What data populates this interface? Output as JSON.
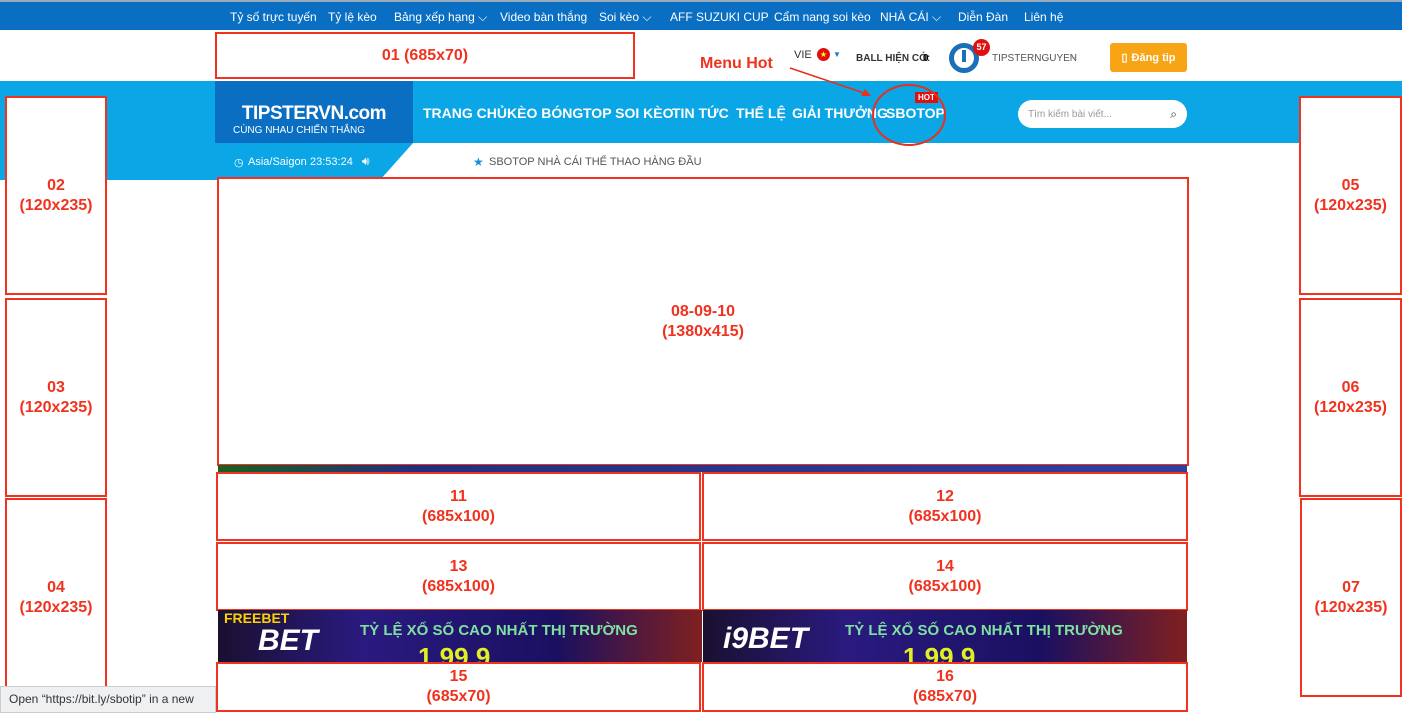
{
  "topnav": [
    "Tỷ số trực tuyến",
    "Tỷ lệ kèo",
    "Bảng xếp hạng ⌵",
    "Video bàn thắng",
    "Soi kèo ⌵",
    "AFF SUZUKI CUP",
    "Cẩm nang soi kèo",
    "NHÀ CÁI ⌵",
    "Diễn Đàn",
    "Liên hệ"
  ],
  "header": {
    "lang": "VIE",
    "ball_label": "BALL HIỆN CÓ:",
    "ball_value": "0",
    "notif_count": "57",
    "username": "TIPSTERNGUYEN",
    "post_tip": "Đăng tip"
  },
  "logo": {
    "name": "TIPSTERVN.com",
    "tagline": "CÙNG NHAU CHIẾN THẮNG"
  },
  "mainnav": [
    "TRANG CHỦ",
    "KÈO BÓNG",
    "TOP SOI KÈO",
    "TIN TỨC",
    "THỂ LỆ",
    "GIẢI THƯỞNG",
    "SBOTOP"
  ],
  "hot_badge": "HOT",
  "search": {
    "placeholder": "Tìm kiếm bài viết..."
  },
  "clock": {
    "tz": "Asia/Saigon",
    "time": "23:53:24"
  },
  "ticker": "SBOTOP NHÀ CÁI THỂ THAO HÀNG ĐẦU",
  "annotation": "Menu Hot",
  "slots": {
    "s01": [
      "01 (685x70)"
    ],
    "s02": [
      "02",
      "(120x235)"
    ],
    "s03": [
      "03",
      "(120x235)"
    ],
    "s04": [
      "04",
      "(120x235)"
    ],
    "s05": [
      "05",
      "(120x235)"
    ],
    "s06": [
      "06",
      "(120x235)"
    ],
    "s07": [
      "07",
      "(120x235)"
    ],
    "s08": [
      "08-09-10",
      "(1380x415)"
    ],
    "s11": [
      "11",
      "(685x100)"
    ],
    "s12": [
      "12",
      "(685x100)"
    ],
    "s13": [
      "13",
      "(685x100)"
    ],
    "s14": [
      "14",
      "(685x100)"
    ],
    "s15": [
      "15",
      "(685x70)"
    ],
    "s16": [
      "16",
      "(685x70)"
    ]
  },
  "banner": {
    "brand1": "BET",
    "brand2": "i9BET",
    "headline": "TỶ LỆ XỔ SỐ CAO NHẤT THỊ TRƯỜNG",
    "value": "1.99,9",
    "promo": "FREEBET"
  },
  "status_url": "Open “https://bit.ly/sbotip” in a new"
}
